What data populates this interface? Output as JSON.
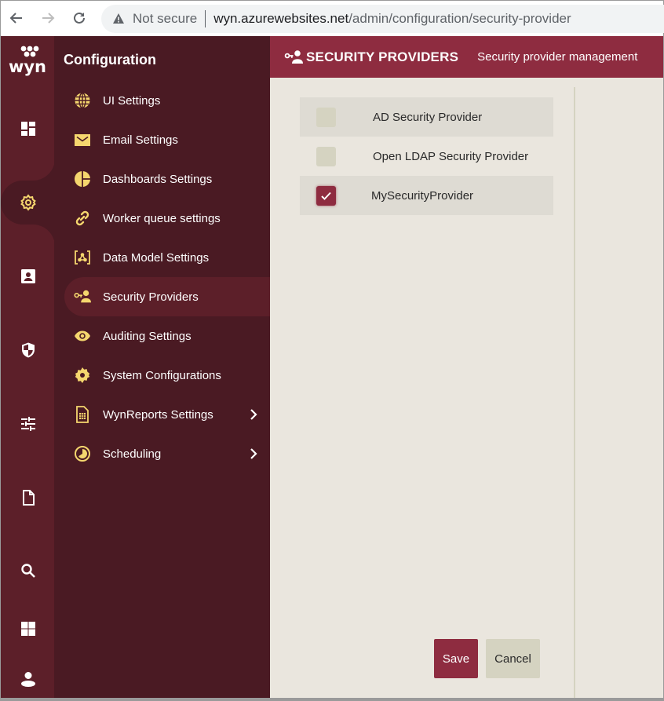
{
  "browser": {
    "security_label": "Not secure",
    "url_host": "wyn.azurewebsites.net",
    "url_path": "/admin/configuration/security-provider"
  },
  "brand": {
    "logo_text": "wyn",
    "accent": "#8e2c40",
    "rail_bg": "#5c1f29",
    "menu_bg": "#4a1a23",
    "icon_yellow": "#f5d66e"
  },
  "rail": {
    "items": [
      {
        "icon": "dashboard-icon",
        "active": false
      },
      {
        "icon": "gear-icon",
        "active": true
      },
      {
        "icon": "contact-card-icon",
        "active": false
      },
      {
        "icon": "shield-icon",
        "active": false
      },
      {
        "icon": "sliders-icon",
        "active": false
      },
      {
        "icon": "document-icon",
        "active": false
      },
      {
        "icon": "search-icon",
        "active": false
      },
      {
        "icon": "apps-grid-icon",
        "active": false
      },
      {
        "icon": "user-icon",
        "active": false
      }
    ]
  },
  "menu": {
    "title": "Configuration",
    "items": [
      {
        "label": "UI Settings",
        "icon": "globe-icon",
        "active": false,
        "has_children": false
      },
      {
        "label": "Email Settings",
        "icon": "envelope-icon",
        "active": false,
        "has_children": false
      },
      {
        "label": "Dashboards Settings",
        "icon": "pie-chart-icon",
        "active": false,
        "has_children": false
      },
      {
        "label": "Worker queue settings",
        "icon": "link-icon",
        "active": false,
        "has_children": false
      },
      {
        "label": "Data Model Settings",
        "icon": "data-model-icon",
        "active": false,
        "has_children": false
      },
      {
        "label": "Security Providers",
        "icon": "key-user-icon",
        "active": true,
        "has_children": false
      },
      {
        "label": "Auditing Settings",
        "icon": "eye-icon",
        "active": false,
        "has_children": false
      },
      {
        "label": "System Configurations",
        "icon": "cog-icon",
        "active": false,
        "has_children": false
      },
      {
        "label": "WynReports Settings",
        "icon": "report-sheet-icon",
        "active": false,
        "has_children": true
      },
      {
        "label": "Scheduling",
        "icon": "clock-icon",
        "active": false,
        "has_children": true
      }
    ]
  },
  "header": {
    "title": "SECURITY PROVIDERS",
    "subtitle": "Security provider management"
  },
  "providers": [
    {
      "label": "AD Security Provider",
      "checked": false
    },
    {
      "label": "Open LDAP Security Provider",
      "checked": false
    },
    {
      "label": "MySecurityProvider",
      "checked": true
    }
  ],
  "actions": {
    "save_label": "Save",
    "cancel_label": "Cancel"
  }
}
